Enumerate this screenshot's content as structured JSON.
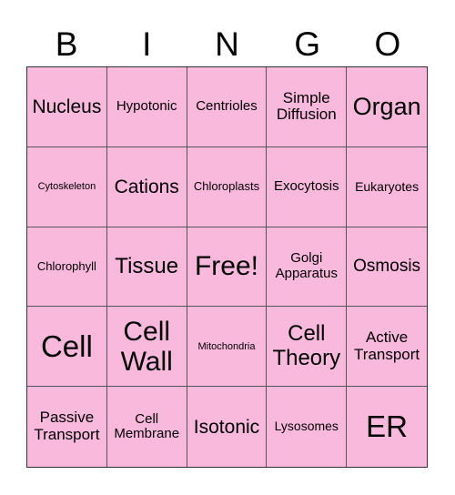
{
  "header": [
    "B",
    "I",
    "N",
    "G",
    "O"
  ],
  "cells": [
    "Nucleus",
    "Hypotonic",
    "Centrioles",
    "Simple Diffusion",
    "Organ",
    "Cytoskeleton",
    "Cations",
    "Chloroplasts",
    "Exocytosis",
    "Eukaryotes",
    "Chlorophyll",
    "Tissue",
    "Free!",
    "Golgi Apparatus",
    "Osmosis",
    "Cell",
    "Cell Wall",
    "Mitochondria",
    "Cell Theory",
    "Active Transport",
    "Passive Transport",
    "Cell Membrane",
    "Isotonic",
    "Lysosomes",
    "ER"
  ],
  "colors": {
    "cell_fill": "#f9b9dd",
    "border": "#555555"
  }
}
